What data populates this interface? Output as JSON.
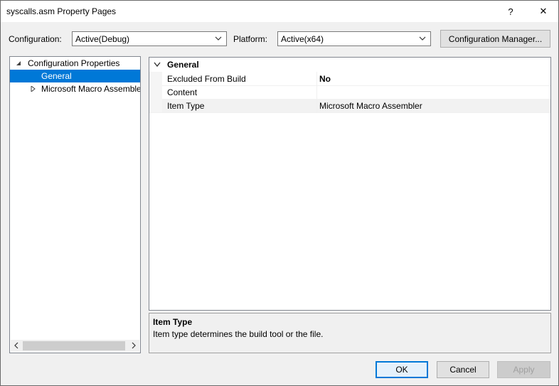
{
  "window": {
    "title": "syscalls.asm Property Pages",
    "help": "?",
    "close": "✕"
  },
  "toolbar": {
    "configuration_label": "Configuration:",
    "configuration_value": "Active(Debug)",
    "platform_label": "Platform:",
    "platform_value": "Active(x64)",
    "config_manager": "Configuration Manager..."
  },
  "tree": {
    "items": [
      {
        "label": "Configuration Properties",
        "expanded": true
      },
      {
        "label": "General",
        "selected": true
      },
      {
        "label": "Microsoft Macro Assembler",
        "expanded": false
      }
    ]
  },
  "grid": {
    "category": "General",
    "rows": [
      {
        "name": "Excluded From Build",
        "value": "No"
      },
      {
        "name": "Content",
        "value": ""
      },
      {
        "name": "Item Type",
        "value": "Microsoft Macro Assembler"
      }
    ]
  },
  "description": {
    "title": "Item Type",
    "text": "Item type determines the build tool or the file."
  },
  "buttons": {
    "ok": "OK",
    "cancel": "Cancel",
    "apply": "Apply"
  },
  "colors": {
    "accent": "#0078d7",
    "background": "#f0f0f0"
  }
}
